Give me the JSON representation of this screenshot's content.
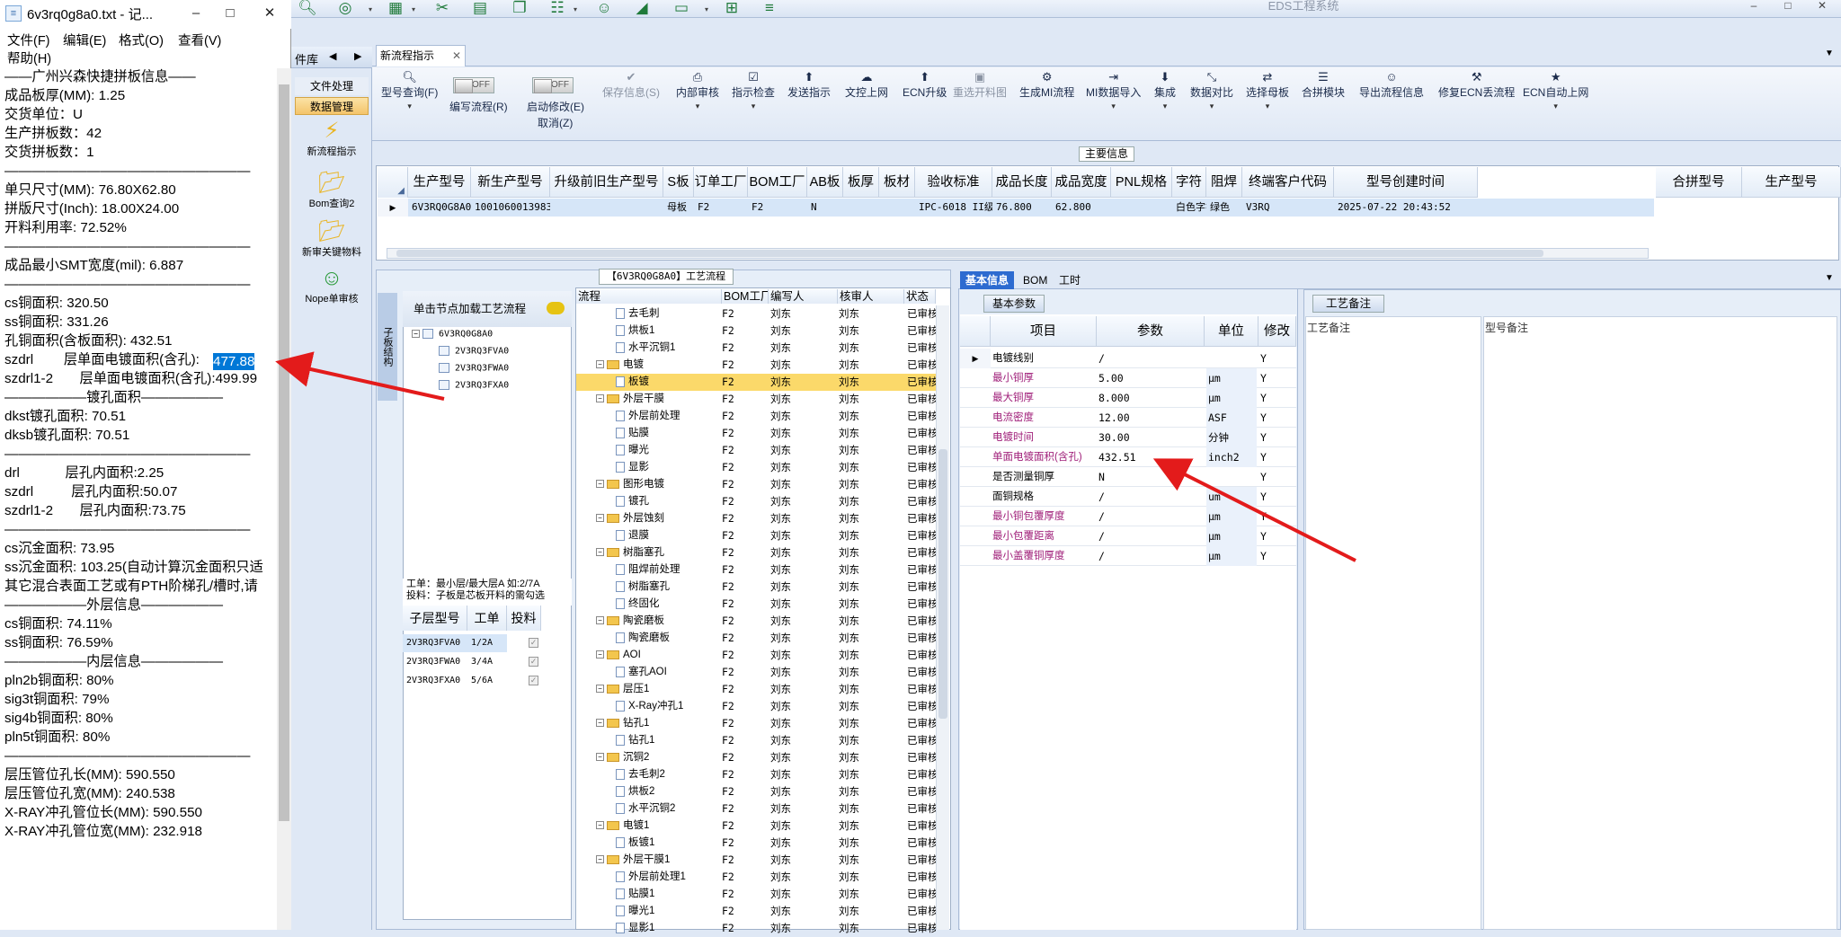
{
  "app": {
    "title": "EDS工程系统",
    "accent": "#2d6bd0"
  },
  "notepad": {
    "title": "6v3rq0g8a0.txt - 记...",
    "menu": [
      "文件(F)",
      "编辑(E)",
      "格式(O)",
      "查看(V)",
      "帮助(H)"
    ],
    "lines": [
      "——广州兴森快捷拼板信息——",
      "成品板厚(MM): 1.25",
      "交货单位：U",
      "生产拼板数：42",
      "交货拼板数：1",
      "——————————————————",
      "单只尺寸(MM): 76.80X62.80",
      "拼版尺寸(Inch): 18.00X24.00",
      "开料利用率: 72.52%",
      "——————————————————",
      "成品最小SMT宽度(mil): 6.887",
      "——————————————————",
      "cs铜面积: 320.50",
      "ss铜面积: 331.26",
      "孔铜面积(含板面积): 432.51",
      "szdrl        层单面电镀面积(含孔):",
      "szdrl1-2       层单面电镀面积(含孔):499.99",
      "——————镀孔面积——————",
      "dkst镀孔面积: 70.51",
      "dksb镀孔面积: 70.51",
      "——————————————————",
      "drl            层孔内面积:2.25",
      "szdrl          层孔内面积:50.07",
      "szdrl1-2       层孔内面积:73.75",
      "——————————————————",
      "cs沉金面积: 73.95",
      "ss沉金面积: 103.25(自动计算沉金面积只适",
      "其它混合表面工艺或有PTH阶梯孔/槽时,请",
      "——————外层信息——————",
      "cs铜面积: 74.11%",
      "ss铜面积: 76.59%",
      "——————内层信息——————",
      "pln2b铜面积: 80%",
      "sig3t铜面积: 79%",
      "sig4b铜面积: 80%",
      "pln5t铜面积: 80%",
      "——————————————————",
      "层压管位孔长(MM): 590.550",
      "层压管位孔宽(MM): 240.538",
      "X-RAY冲孔管位长(MM): 590.550",
      "X-RAY冲孔管位宽(MM): 232.918"
    ],
    "highlight": "477.88"
  },
  "leftnav": {
    "header": "件库",
    "tabs": [
      "文件处理",
      "数据管理"
    ],
    "items": [
      "新流程指示",
      "Bom查询2",
      "新审关键物料",
      "Nope单审核"
    ]
  },
  "main": {
    "tab": "新流程指示",
    "ribbon": [
      "型号查询(F)",
      "编写流程(R)",
      "启动修改(E)",
      "取消(Z)",
      "保存信息(S)",
      "内部审核",
      "指示检查",
      "发送指示",
      "文控上网",
      "ECN升级",
      "重选开料图",
      "生成MI流程",
      "MI数据导入",
      "集成",
      "数据对比",
      "选择母板",
      "合拼模块",
      "导出流程信息",
      "修复ECN丢流程",
      "ECN自动上网"
    ],
    "toggle": "OFF",
    "section": "主要信息",
    "grid": {
      "headers": [
        "生产型号",
        "新生产型号",
        "升级前旧生产型号",
        "S板",
        "订单工厂",
        "BOM工厂",
        "AB板",
        "板厚",
        "板材",
        "验收标准",
        "成品长度",
        "成品宽度",
        "PNL规格",
        "字符",
        "阻焊",
        "终端客户代码",
        "型号创建时间",
        "合拼型号",
        "生产型号"
      ],
      "row": [
        "6V3RQ0G8A0",
        "10010600139839",
        "",
        "母板",
        "F2",
        "F2",
        "N",
        "",
        "",
        "IPC-6018 II级",
        "76.800",
        "62.800",
        "",
        "白色字符",
        "绿色",
        "V3RQ",
        "2025-07-22 20:43:52"
      ]
    }
  },
  "flow": {
    "title": "【6V3RQ0G8A0】工艺流程",
    "vtab": "子板结构",
    "tree_header": "单击节点加载工艺流程",
    "tree": [
      "6V3RQ0G8A0",
      "2V3RQ3FVA0",
      "2V3RQ3FWA0",
      "2V3RQ3FXA0"
    ],
    "info1": "工单：最小层/最大层A 如:2/7A",
    "info2": "投料：子板是芯板开料的需勾选",
    "sub_headers": [
      "子层型号",
      "工单",
      "投料"
    ],
    "sub_rows": [
      [
        "2V3RQ3FVA0",
        "1/2A"
      ],
      [
        "2V3RQ3FWA0",
        "3/4A"
      ],
      [
        "2V3RQ3FXA0",
        "5/6A"
      ]
    ],
    "proc_headers": [
      "流程",
      "BOM工厂",
      "编写人",
      "核审人",
      "状态"
    ],
    "proc_rows": [
      {
        "n": "去毛刺",
        "lv": 2,
        "t": "doc"
      },
      {
        "n": "烘板1",
        "lv": 2,
        "t": "doc"
      },
      {
        "n": "水平沉铜1",
        "lv": 2,
        "t": "doc"
      },
      {
        "n": "电镀",
        "lv": 1,
        "t": "fold"
      },
      {
        "n": "板镀",
        "lv": 2,
        "t": "doc",
        "sel": true
      },
      {
        "n": "外层干膜",
        "lv": 1,
        "t": "fold"
      },
      {
        "n": "外层前处理",
        "lv": 2,
        "t": "doc"
      },
      {
        "n": "贴膜",
        "lv": 2,
        "t": "doc"
      },
      {
        "n": "曝光",
        "lv": 2,
        "t": "doc"
      },
      {
        "n": "显影",
        "lv": 2,
        "t": "doc"
      },
      {
        "n": "图形电镀",
        "lv": 1,
        "t": "fold"
      },
      {
        "n": "镀孔",
        "lv": 2,
        "t": "doc"
      },
      {
        "n": "外层蚀刻",
        "lv": 1,
        "t": "fold"
      },
      {
        "n": "退膜",
        "lv": 2,
        "t": "doc"
      },
      {
        "n": "树脂塞孔",
        "lv": 1,
        "t": "fold"
      },
      {
        "n": "阻焊前处理",
        "lv": 2,
        "t": "doc"
      },
      {
        "n": "树脂塞孔",
        "lv": 2,
        "t": "doc"
      },
      {
        "n": "终固化",
        "lv": 2,
        "t": "doc"
      },
      {
        "n": "陶瓷磨板",
        "lv": 1,
        "t": "fold"
      },
      {
        "n": "陶瓷磨板",
        "lv": 2,
        "t": "doc"
      },
      {
        "n": "AOI",
        "lv": 1,
        "t": "fold"
      },
      {
        "n": "塞孔AOI",
        "lv": 2,
        "t": "doc"
      },
      {
        "n": "层压1",
        "lv": 1,
        "t": "fold"
      },
      {
        "n": "X-Ray冲孔1",
        "lv": 2,
        "t": "doc"
      },
      {
        "n": "钻孔1",
        "lv": 1,
        "t": "fold"
      },
      {
        "n": "钻孔1",
        "lv": 2,
        "t": "doc"
      },
      {
        "n": "沉铜2",
        "lv": 1,
        "t": "fold"
      },
      {
        "n": "去毛刺2",
        "lv": 2,
        "t": "doc"
      },
      {
        "n": "烘板2",
        "lv": 2,
        "t": "doc"
      },
      {
        "n": "水平沉铜2",
        "lv": 2,
        "t": "doc"
      },
      {
        "n": "电镀1",
        "lv": 1,
        "t": "fold"
      },
      {
        "n": "板镀1",
        "lv": 2,
        "t": "doc"
      },
      {
        "n": "外层干膜1",
        "lv": 1,
        "t": "fold"
      },
      {
        "n": "外层前处理1",
        "lv": 2,
        "t": "doc"
      },
      {
        "n": "贴膜1",
        "lv": 2,
        "t": "doc"
      },
      {
        "n": "曝光1",
        "lv": 2,
        "t": "doc"
      },
      {
        "n": "显影1",
        "lv": 2,
        "t": "doc"
      }
    ],
    "proc_common": {
      "factory": "F2",
      "writer": "刘东",
      "checker": "刘东",
      "status": "已审核"
    }
  },
  "basic": {
    "tabs": [
      "基本信息",
      "BOM",
      "工时"
    ],
    "subtab": "基本参数",
    "headers": [
      "项目",
      "参数",
      "单位",
      "修改"
    ],
    "rows": [
      {
        "item": "电镀线别",
        "val": "/",
        "unit": "",
        "mod": "Y",
        "color": "#000"
      },
      {
        "item": "最小铜厚",
        "val": "5.00",
        "unit": "μm",
        "mod": "Y",
        "color": "#a0207a"
      },
      {
        "item": "最大铜厚",
        "val": "8.000",
        "unit": "μm",
        "mod": "Y",
        "color": "#a0207a"
      },
      {
        "item": "电流密度",
        "val": "12.00",
        "unit": "ASF",
        "mod": "Y",
        "color": "#a0207a"
      },
      {
        "item": "电镀时间",
        "val": "30.00",
        "unit": "分钟",
        "mod": "Y",
        "color": "#a0207a"
      },
      {
        "item": "单面电镀面积(含孔)",
        "val": "432.51",
        "unit": "inch2",
        "mod": "Y",
        "color": "#a0207a"
      },
      {
        "item": "是否测量铜厚",
        "val": "N",
        "unit": "",
        "mod": "Y",
        "color": "#000"
      },
      {
        "item": "面铜规格",
        "val": "/",
        "unit": "um",
        "mod": "Y",
        "color": "#000"
      },
      {
        "item": "最小铜包覆厚度",
        "val": "/",
        "unit": "μm",
        "mod": "Y",
        "color": "#a0207a"
      },
      {
        "item": "最小包覆距离",
        "val": "/",
        "unit": "μm",
        "mod": "Y",
        "color": "#a0207a"
      },
      {
        "item": "最小盖覆铜厚度",
        "val": "/",
        "unit": "μm",
        "mod": "Y",
        "color": "#a0207a"
      }
    ]
  },
  "remark": {
    "title": "工艺备注",
    "labels": [
      "工艺备注",
      "型号备注"
    ]
  }
}
